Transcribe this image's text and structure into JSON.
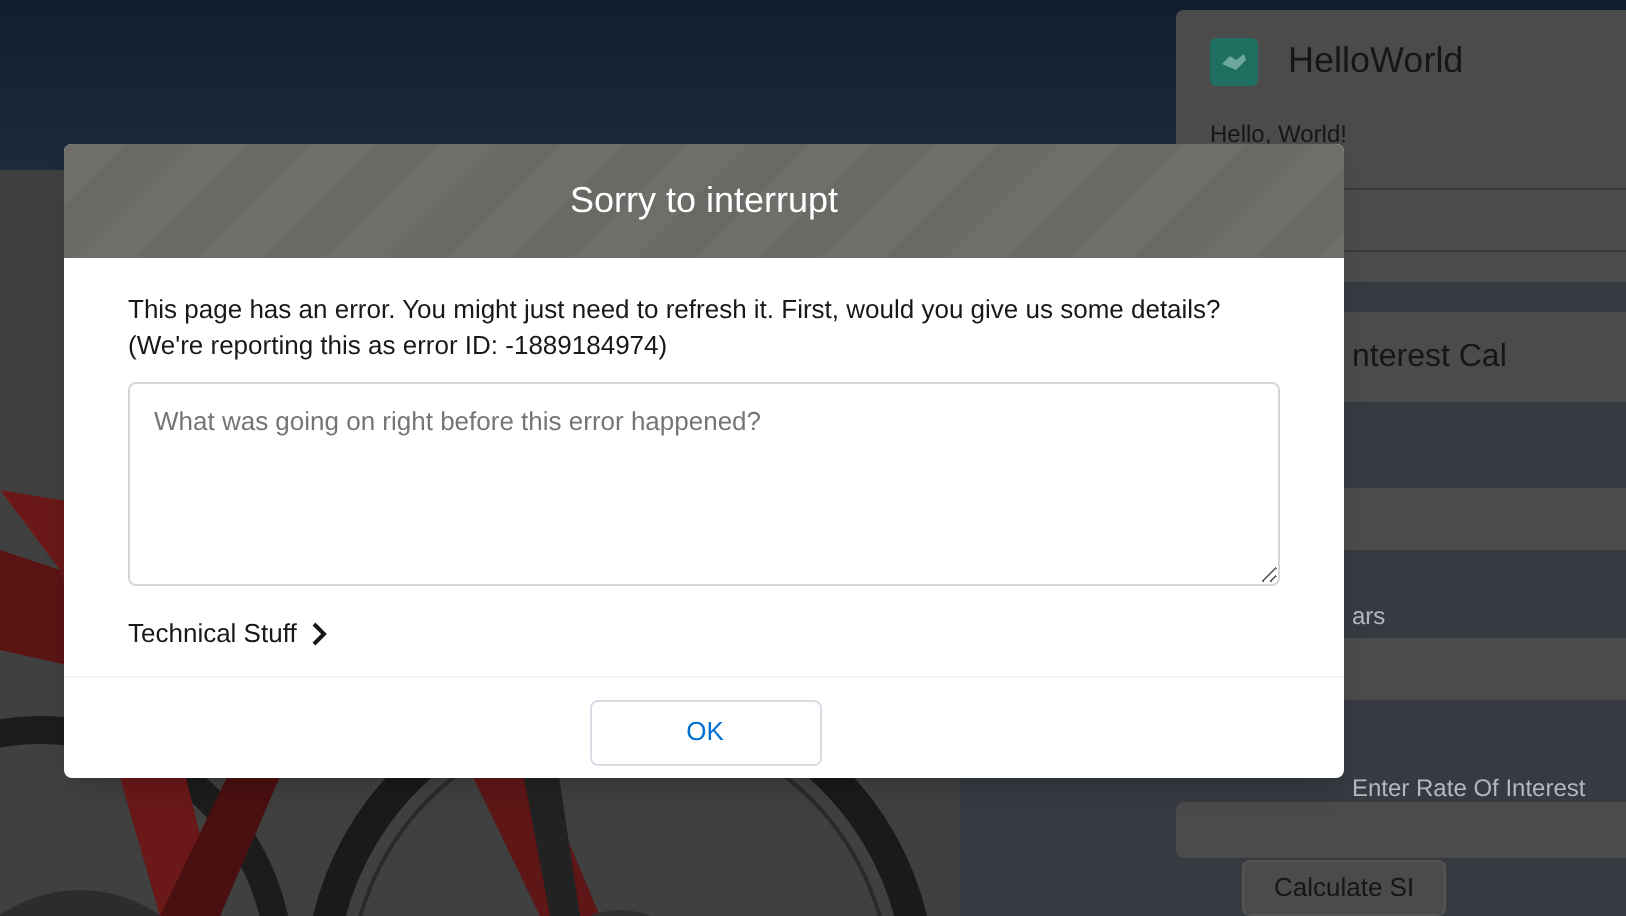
{
  "hello_card": {
    "title": "HelloWorld",
    "text": "Hello, World!"
  },
  "interest_card": {
    "title": "nterest Cal",
    "fields": [
      {
        "kind": "unlabeled"
      },
      {
        "kind": "labeled",
        "label": "ars"
      },
      {
        "kind": "labeled",
        "label": "Enter Rate Of Interest"
      }
    ],
    "button": "Calculate SI"
  },
  "dialog": {
    "title": "Sorry to interrupt",
    "message": "This page has an error. You might just need to refresh it. First, would you give us some details?",
    "error_line": "(We're reporting this as error ID: -1889184974)",
    "details_field": {
      "placeholder": "What was going on right before this error happened?"
    },
    "technical_toggle": {
      "label": "Technical Stuff",
      "expanded": false
    },
    "ok_button": "OK"
  }
}
